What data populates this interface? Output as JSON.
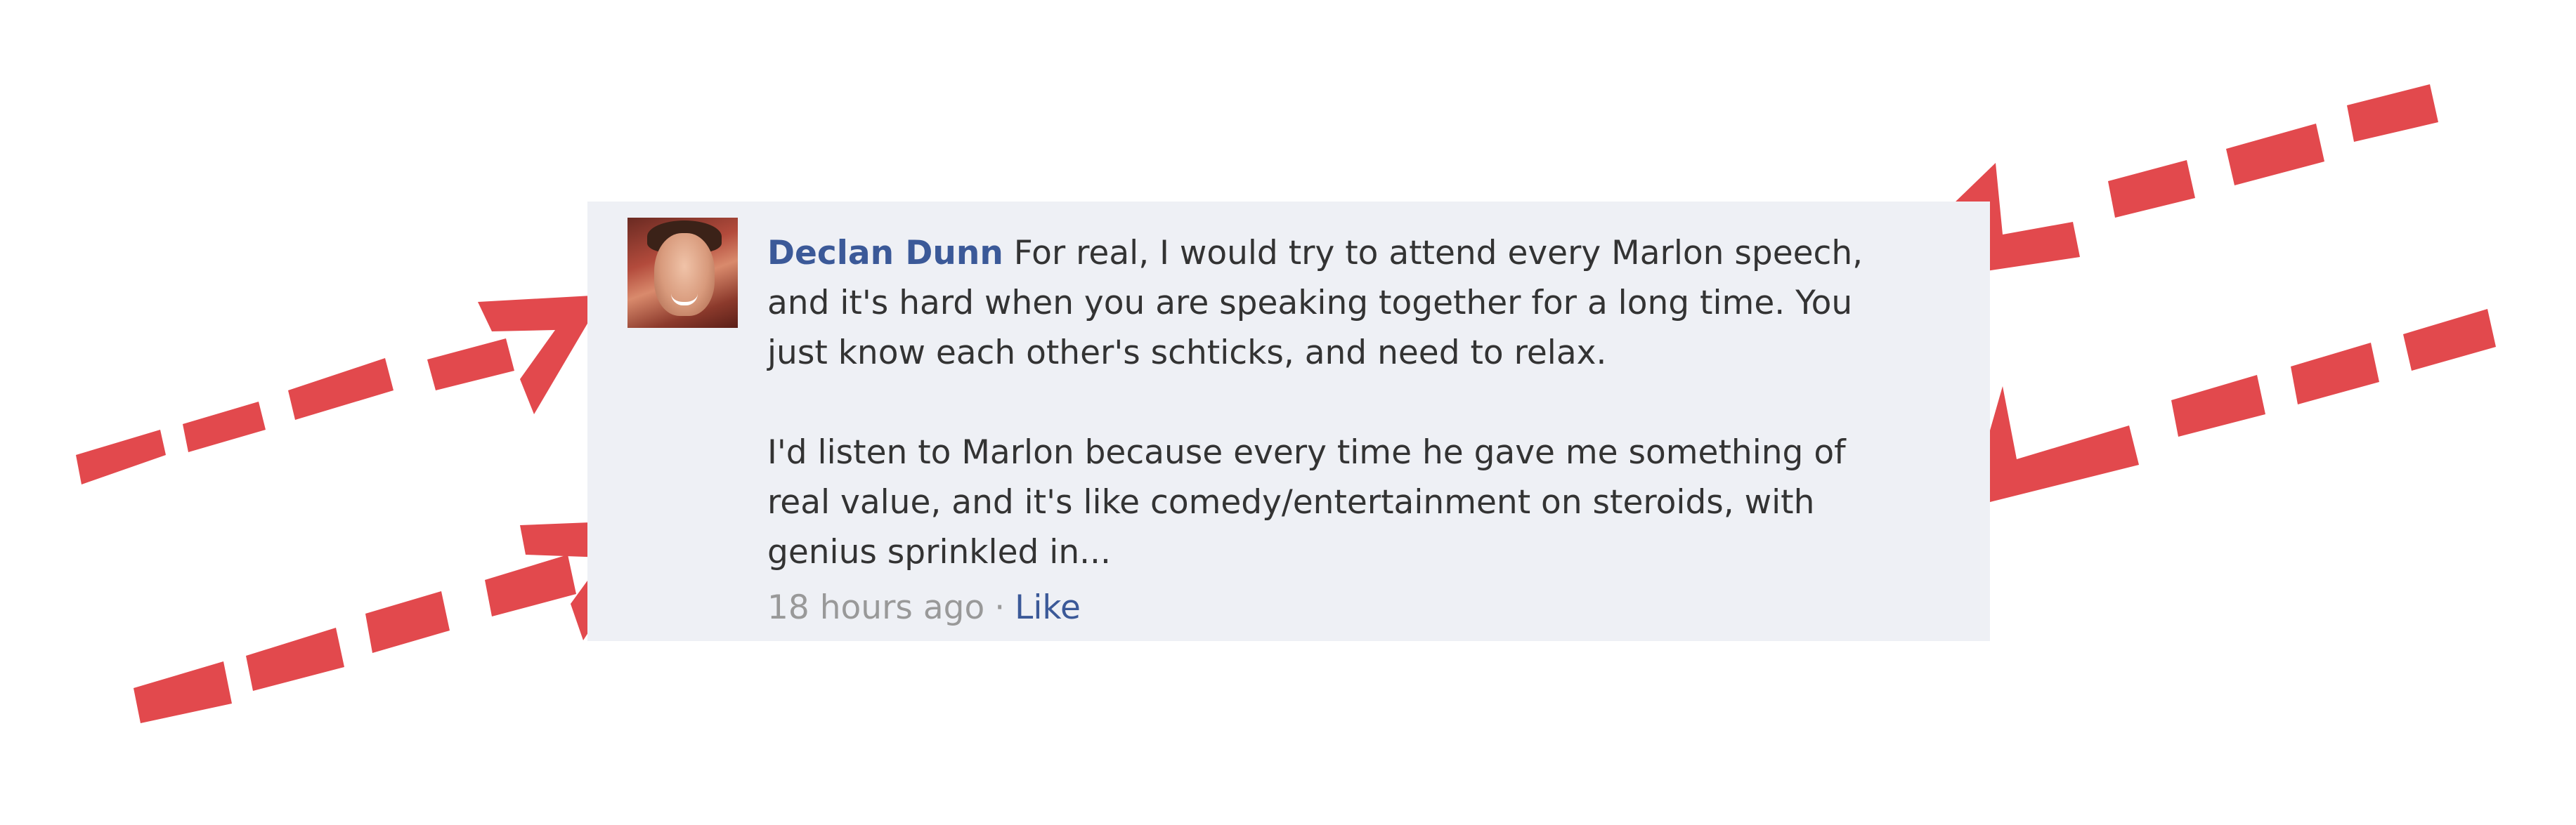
{
  "comment": {
    "author": "Declan Dunn",
    "paragraph_1": "For real, I would try to attend every Marlon speech, and it's hard when you are speaking together for a long time. You just know each other's schticks, and need to relax.",
    "paragraph_2": "I'd listen to Marlon because every time he gave me something of real value, and it's like comedy/entertainment on steroids, with genius sprinkled in...",
    "timestamp": "18 hours ago",
    "separator": "·",
    "like_label": "Like"
  },
  "colors": {
    "link": "#3b5998",
    "text": "#333333",
    "muted": "#999999",
    "card_background": "#eef0f5",
    "annotation_arrow": "#e03a3e"
  }
}
